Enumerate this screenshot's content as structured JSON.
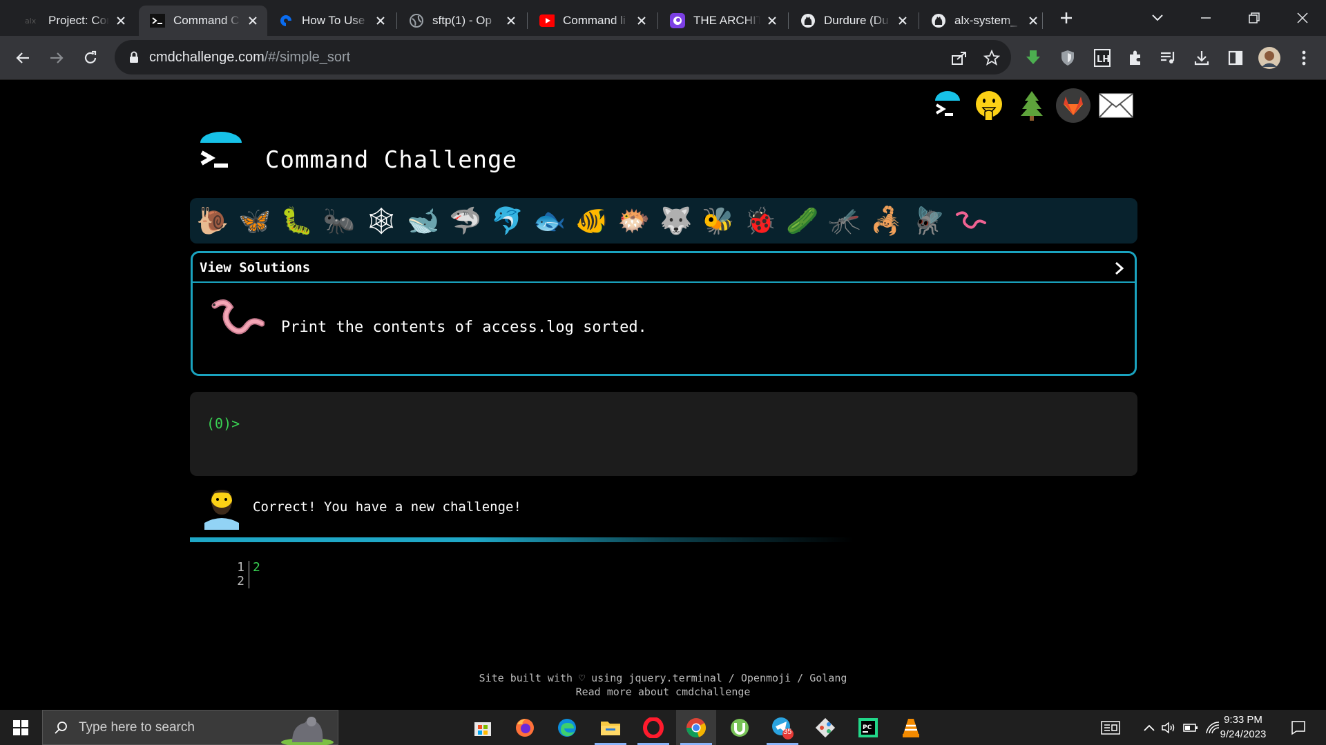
{
  "browser": {
    "tabs": [
      {
        "title": "Project: Con",
        "favicon": "alx-icon"
      },
      {
        "title": "Command C",
        "favicon": "terminal-icon",
        "active": true
      },
      {
        "title": "How To Use",
        "favicon": "digitalocean-icon"
      },
      {
        "title": "sftp(1) - Op",
        "favicon": "globe-icon"
      },
      {
        "title": "Command li",
        "favicon": "youtube-icon"
      },
      {
        "title": "THE ARCHIT",
        "favicon": "app-icon"
      },
      {
        "title": "Durdure (Du",
        "favicon": "github-icon"
      },
      {
        "title": "alx-system_",
        "favicon": "github-icon"
      }
    ],
    "url_host": "cmdchallenge.com",
    "url_path": "/#/simple_sort"
  },
  "page": {
    "title": "Command Challenge",
    "critters": [
      "snail",
      "butterfly",
      "caterpillar",
      "ant",
      "spider-web",
      "whale",
      "shark",
      "dolphin",
      "fish",
      "tropical-fish",
      "blowfish",
      "wolf",
      "bee",
      "lady-beetle",
      "cucumber-worm",
      "mosquito",
      "scorpion",
      "fly",
      "worm"
    ],
    "challenge": {
      "header": "View Solutions",
      "description": "Print the contents of access.log sorted."
    },
    "terminal": {
      "prompt": "(0)>"
    },
    "message": "Correct! You have a new challenge!",
    "output": {
      "line_numbers": "1\n2",
      "value": "2"
    },
    "footer": {
      "line1": "Site built with ♡ using jquery.terminal / Openmoji / Golang",
      "line2": "Read more about cmdchallenge"
    }
  },
  "taskbar": {
    "search_placeholder": "Type here to search",
    "telegram_badge": "35",
    "time": "9:33 PM",
    "date": "9/24/2023"
  }
}
